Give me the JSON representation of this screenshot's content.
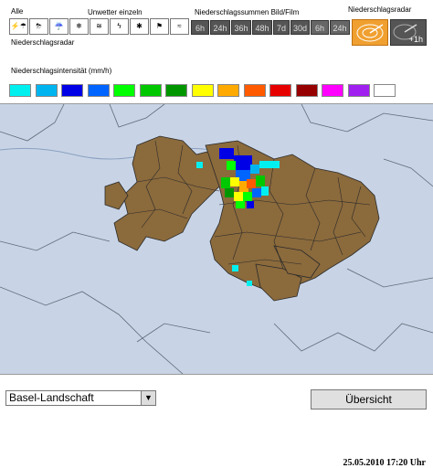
{
  "header": {
    "alle_label": "Alle",
    "unwetter_label": "Unwetter einzeln",
    "niederschlagssummen_label": "Niederschlagssummen Bild/Film",
    "niederschlagsradar_right_label": "Niederschlagsradar",
    "niederschlagsradar_left_label": "Niederschlagsradar"
  },
  "period_buttons": [
    "6h",
    "24h",
    "36h",
    "48h",
    "7d",
    "30d",
    "6h",
    "24h"
  ],
  "radar_button_label": "+1h",
  "legend": {
    "title": "Niederschlagsintensität (mm/h)",
    "colors": [
      "#00f0f0",
      "#00b4f0",
      "#0000e6",
      "#0064ff",
      "#00ff00",
      "#00c800",
      "#009600",
      "#ffff00",
      "#ffaa00",
      "#ff5a00",
      "#e60000",
      "#960000",
      "#ff00ff",
      "#a020f0",
      "#ffffff"
    ]
  },
  "map": {
    "timestamp": "25.05.2010 17:20 Uhr"
  },
  "footer": {
    "region_select": "Basel-Landschaft",
    "overview_button": "Übersicht"
  }
}
